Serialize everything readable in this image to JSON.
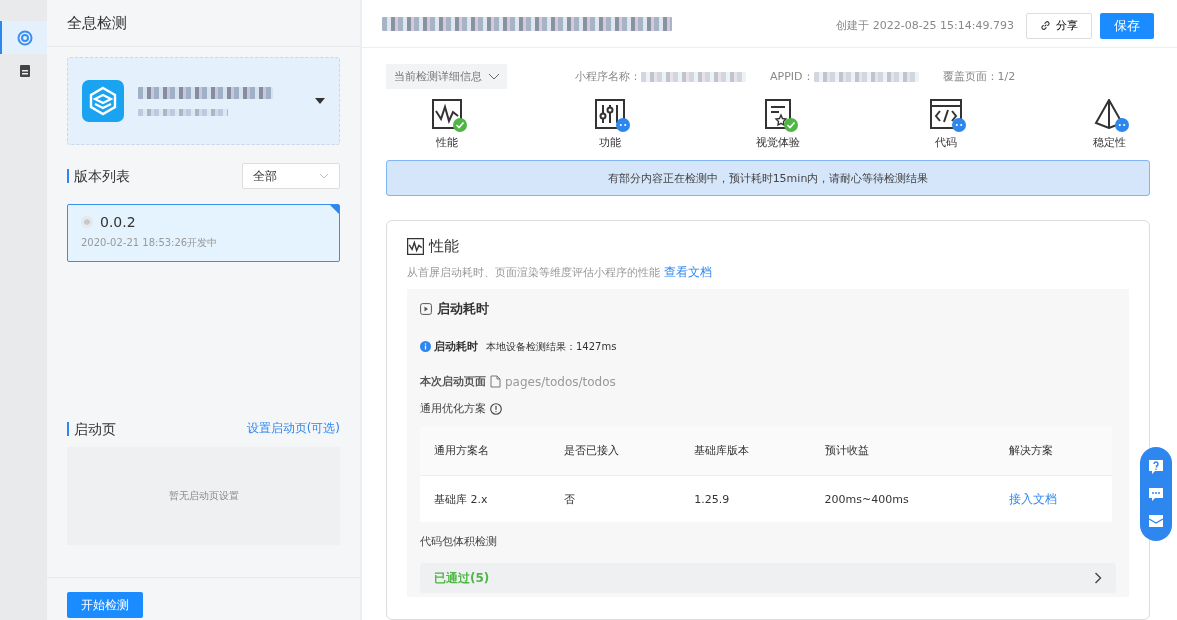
{
  "rail": {
    "items": [
      {
        "selected": true
      },
      {
        "selected": false
      }
    ]
  },
  "sidebar": {
    "title": "全息检测",
    "version_list": {
      "title": "版本列表",
      "filter": "全部",
      "items": [
        {
          "version": "0.0.2",
          "meta": "2020-02-21 18:53:26开发中",
          "selected": true
        }
      ]
    },
    "launch_page": {
      "title": "启动页",
      "link": "设置启动页(可选)",
      "empty_text": "暂无启动页设置"
    },
    "start_button": "开始检测"
  },
  "header": {
    "created": "创建于 2022-08-25 15:14:49.793",
    "share_button": "分享",
    "save_button": "保存"
  },
  "info_bar": {
    "dropdown": "当前检测详细信息",
    "fields": [
      {
        "label": "小程序名称："
      },
      {
        "label": "APPID："
      },
      {
        "label": "覆盖页面：",
        "value": "1/2"
      }
    ]
  },
  "categories": [
    {
      "label": "性能",
      "kind": "monitor",
      "passed": true
    },
    {
      "label": "功能",
      "kind": "sliders",
      "passed": false
    },
    {
      "label": "视觉体验",
      "kind": "document",
      "passed": true
    },
    {
      "label": "代码",
      "kind": "code",
      "passed": false
    },
    {
      "label": "稳定性",
      "kind": "pyramid",
      "passed": false
    }
  ],
  "notice": "有部分内容正在检测中，预计耗时15min内，请耐心等待检测结果",
  "section": {
    "title": "性能",
    "desc": "从首屏启动耗时、页面渲染等维度评估小程序的性能",
    "doc_link": "查看文档",
    "panel": {
      "title": "启动耗时",
      "metric_label": "启动耗时",
      "metric_value": "本地设备检测结果：1427ms",
      "page_label": "本次启动页面",
      "page_path": "pages/todos/todos",
      "plan_title": "通用优化方案",
      "table": {
        "columns": [
          {
            "label": "通用方案名",
            "kind": "text"
          },
          {
            "label": "是否已接入",
            "kind": "text"
          },
          {
            "label": "基础库版本",
            "kind": "text"
          },
          {
            "label": "预计收益",
            "kind": "text"
          },
          {
            "label": "解决方案",
            "kind": "link"
          }
        ],
        "rows": [
          [
            "基础库 2.x",
            "否",
            "1.25.9",
            "200ms~400ms",
            "接入文档"
          ]
        ]
      },
      "size_title": "代码包体积检测",
      "passed_row": "已通过(5)"
    }
  }
}
